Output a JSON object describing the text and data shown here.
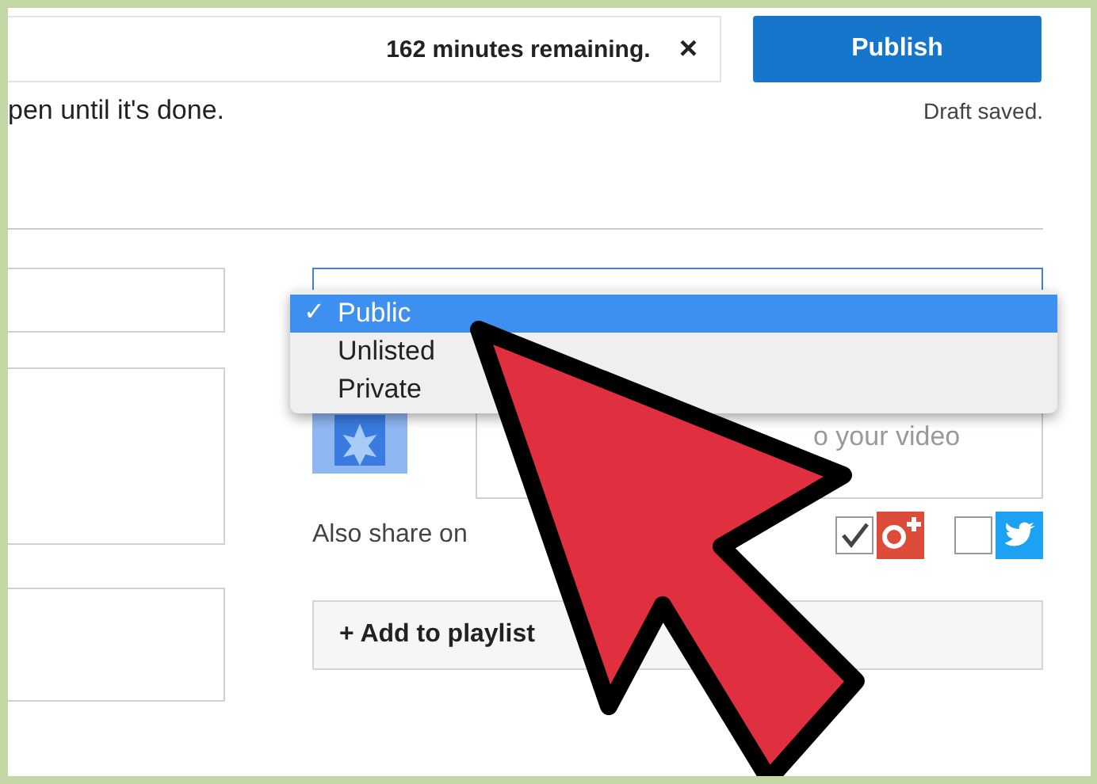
{
  "status": {
    "message": "162 minutes remaining.",
    "close": "×"
  },
  "publish_button": "Publish",
  "note": "pen until it's done.",
  "draft_status": "Draft saved.",
  "privacy_menu": [
    {
      "label": "Public",
      "selected": true,
      "check": "✓"
    },
    {
      "label": "Unlisted",
      "selected": false
    },
    {
      "label": "Private",
      "selected": false
    }
  ],
  "description": {
    "placeholder": "o your video"
  },
  "share": {
    "label": "Also share on",
    "targets": [
      {
        "kind": "gplus",
        "checked": true
      },
      {
        "kind": "twitter",
        "checked": false
      }
    ]
  },
  "playlist_button": "+ Add to playlist"
}
